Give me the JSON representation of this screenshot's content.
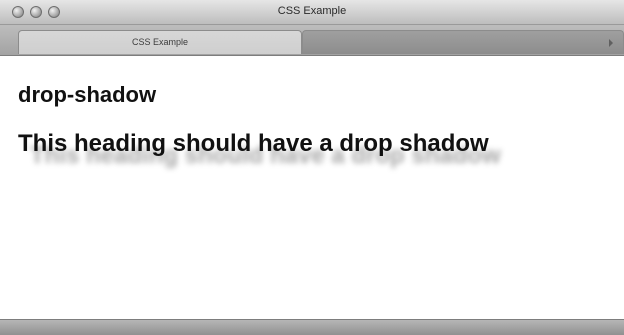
{
  "window": {
    "title": "CSS Example"
  },
  "tabs": [
    {
      "label": "CSS Example"
    }
  ],
  "content": {
    "heading_small": "drop-shadow",
    "heading_large": "This heading should have a drop shadow"
  }
}
